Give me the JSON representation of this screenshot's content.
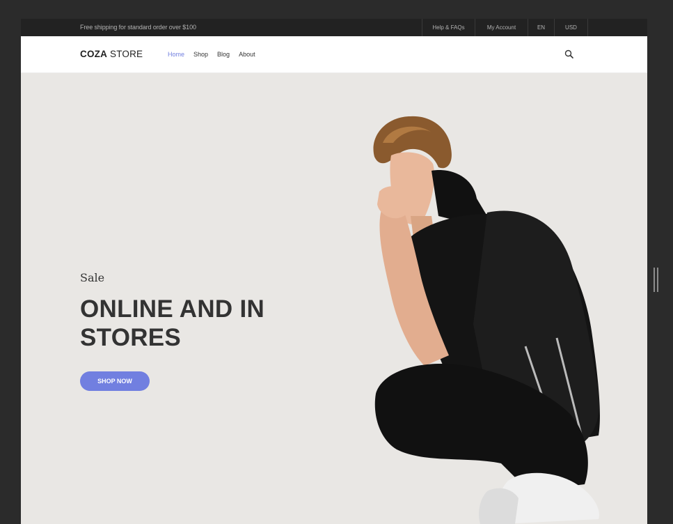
{
  "topbar": {
    "shipping_text": "Free shipping for standard order over $100",
    "links": [
      "Help & FAQs",
      "My Account",
      "EN",
      "USD"
    ]
  },
  "header": {
    "logo_bold": "COZA",
    "logo_regular": " STORE",
    "nav": [
      "Home",
      "Shop",
      "Blog",
      "About"
    ],
    "active_nav": "Home",
    "search_icon": "search-icon"
  },
  "hero": {
    "tagline": "Sale",
    "headline": "ONLINE AND IN STORES",
    "button_label": "SHOP NOW"
  },
  "colors": {
    "accent": "#717fe0",
    "topbar_bg": "#222222",
    "hero_bg": "#e9e7e4",
    "text_dark": "#333333"
  }
}
